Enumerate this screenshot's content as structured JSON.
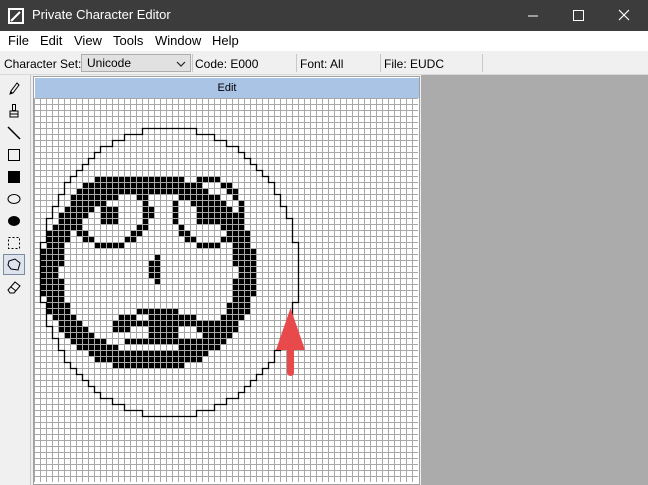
{
  "window": {
    "title": "Private Character Editor"
  },
  "menu": [
    "File",
    "Edit",
    "View",
    "Tools",
    "Window",
    "Help"
  ],
  "infobar": {
    "charset_label": "Character Set:",
    "charset_value": "Unicode",
    "code": "Code: E000",
    "font": "Font: All",
    "file": "File: EUDC"
  },
  "tools": [
    {
      "name": "pencil-tool",
      "icon": "pencil-icon"
    },
    {
      "name": "brush-tool",
      "icon": "brush-icon"
    },
    {
      "name": "line-tool",
      "icon": "line-icon"
    },
    {
      "name": "hollow-rectangle-tool",
      "icon": "rectangle-outline-icon"
    },
    {
      "name": "filled-rectangle-tool",
      "icon": "rectangle-filled-icon"
    },
    {
      "name": "hollow-ellipse-tool",
      "icon": "ellipse-outline-icon"
    },
    {
      "name": "filled-ellipse-tool",
      "icon": "ellipse-filled-icon"
    },
    {
      "name": "rectangular-selection-tool",
      "icon": "rect-select-icon"
    },
    {
      "name": "freeform-selection-tool",
      "icon": "freeform-select-icon",
      "selected": true
    },
    {
      "name": "eraser-tool",
      "icon": "eraser-icon"
    }
  ],
  "edit_panel": {
    "title": "Edit",
    "grid_cells": 64
  },
  "colors": {
    "titlebar": "#3c3c3c",
    "edit_header": "#aac4e6",
    "grid_line": "#a8a8a8",
    "pixel_on": "#000000",
    "annotation_arrow": "#e8494b",
    "workspace": "#ababab"
  }
}
